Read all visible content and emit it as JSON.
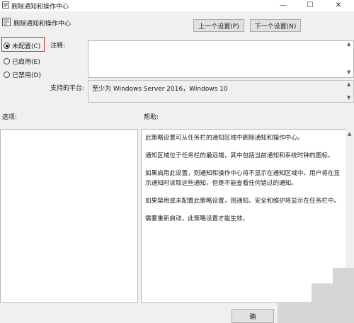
{
  "window": {
    "title": "删除通知和操作中心",
    "controls": {
      "minimize": "—",
      "maximize": "☐",
      "close": "✕"
    }
  },
  "header": {
    "policy_name": "删除通知和操作中心",
    "prev_button": "上一个设置(P)",
    "next_button": "下一个设置(N)"
  },
  "radios": [
    {
      "label": "未配置(C)",
      "selected": true
    },
    {
      "label": "已启用(E)",
      "selected": false
    },
    {
      "label": "已禁用(D)",
      "selected": false
    }
  ],
  "comment": {
    "label": "注释:",
    "value": ""
  },
  "supported": {
    "label": "支持的平台:",
    "value": "至少为 Windows Server 2016，Windows 10"
  },
  "options": {
    "label": "选项:"
  },
  "help": {
    "label": "帮助:",
    "paragraphs": [
      "此策略设置可从任务栏的通知区域中删除通知和操作中心。",
      "通知区域位于任务栏的最远端，其中包括当前通知和系统时钟的图标。",
      "如果启用此设置，则通知和操作中心将不显示在通知区域中。用户将在显示通知时读取这些通知，但是不能查看任何错过的通知。",
      "如果禁用或未配置此策略设置，则通知、安全和维护将显示在任务栏中。",
      "需要重新启动，此策略设置才能生效。"
    ]
  },
  "footer": {
    "ok_button": "确"
  },
  "icons": {
    "app": "policy-icon",
    "header": "policy-icon",
    "scroll_up": "▲",
    "scroll_down": "▼"
  },
  "colors": {
    "highlight": "#d9232d",
    "background": "#f0f0f0"
  }
}
